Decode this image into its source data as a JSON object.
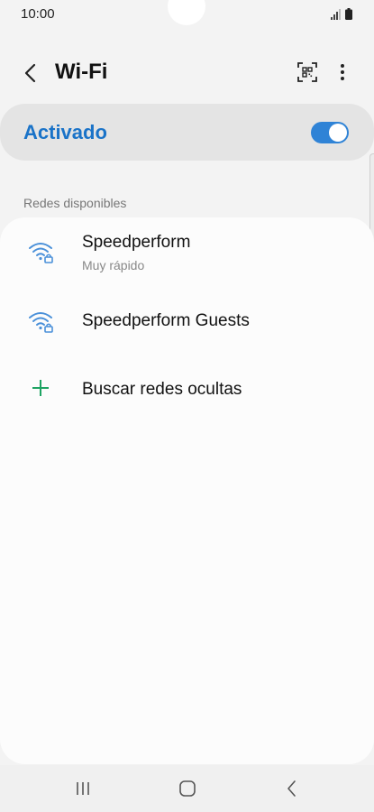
{
  "status_bar": {
    "time": "10:00",
    "icons": [
      "signal-icon",
      "battery-icon"
    ]
  },
  "header": {
    "title": "Wi-Fi",
    "back_icon": "back-arrow-icon",
    "qr_icon": "qr-scan-icon",
    "more_icon": "more-vertical-icon"
  },
  "wifi_toggle": {
    "label": "Activado",
    "state": "on",
    "accent_color": "#2f83d6"
  },
  "available_networks": {
    "section_title": "Redes disponibles",
    "items": [
      {
        "name": "Speedperform",
        "subtitle": "Muy rápido",
        "icon": "wifi-lock-icon"
      },
      {
        "name": "Speedperform Guests",
        "subtitle": "",
        "icon": "wifi-lock-icon"
      }
    ],
    "add_hidden": {
      "label": "Buscar redes ocultas",
      "icon": "plus-icon",
      "icon_color": "#1fa463"
    }
  },
  "nav_bar": {
    "recent_icon": "recent-apps-icon",
    "home_icon": "home-icon",
    "back_icon": "nav-back-icon"
  }
}
